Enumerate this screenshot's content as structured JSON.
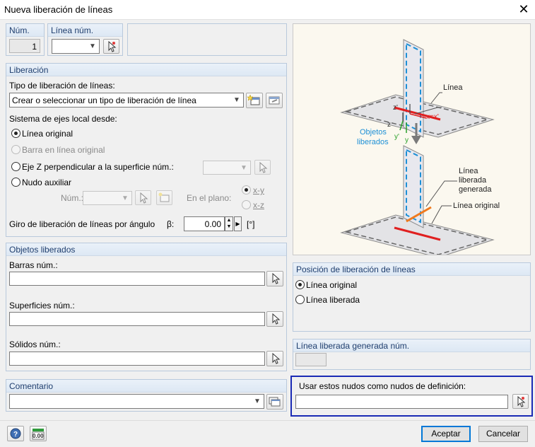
{
  "window": {
    "title": "Nueva liberación de líneas",
    "close_glyph": "✕"
  },
  "num": {
    "label": "Núm.",
    "value": "1"
  },
  "linea_num": {
    "label": "Línea núm.",
    "value": ""
  },
  "liberacion": {
    "header": "Liberación",
    "tipo_label": "Tipo de liberación de líneas:",
    "tipo_value": "Crear o seleccionar un tipo de liberación de línea",
    "sistema_label": "Sistema de ejes local desde:",
    "options": [
      {
        "label": "Línea original",
        "checked": true,
        "enabled": true
      },
      {
        "label": "Barra en línea original",
        "checked": false,
        "enabled": false
      },
      {
        "label": "Eje Z perpendicular a la superficie núm.:",
        "checked": false,
        "enabled": true
      },
      {
        "label": "Nudo auxiliar",
        "checked": false,
        "enabled": true
      }
    ],
    "nudo_num_label": "Núm.:",
    "en_plano_label": "En el plano:",
    "plano_options": [
      "x-y",
      "x-z"
    ],
    "giro_label": "Giro de liberación de líneas por ángulo",
    "beta_label": "β:",
    "beta_value": "0.00",
    "beta_unit": "[°]"
  },
  "objetos": {
    "header": "Objetos liberados",
    "barras_label": "Barras núm.:",
    "superficies_label": "Superficies núm.:",
    "solidos_label": "Sólidos núm.:"
  },
  "comentario": {
    "header": "Comentario",
    "value": ""
  },
  "diagram": {
    "linea": "Línea",
    "xx": "x=x'",
    "z_prime": "z'",
    "z": "z",
    "y_prime": "y'",
    "y": "y",
    "objetos_1": "Objetos",
    "objetos_2": "liberados",
    "gen_1": "Línea",
    "gen_2": "liberada",
    "gen_3": "generada",
    "linea_original": "Línea original"
  },
  "posicion": {
    "header": "Posición de liberación de líneas",
    "options": [
      {
        "label": "Línea original",
        "checked": true
      },
      {
        "label": "Línea liberada",
        "checked": false
      }
    ]
  },
  "generada": {
    "header": "Línea liberada generada núm.",
    "value": ""
  },
  "nudos": {
    "label": "Usar estos nudos como nudos de definición:",
    "value": ""
  },
  "footer": {
    "units_icon_text": "0.00",
    "ok": "Aceptar",
    "cancel": "Cancelar"
  },
  "colors": {
    "accent": "#0078d7",
    "highlight_border": "#1b2bb5",
    "group_title": "#1f3e6e",
    "diagram_blue": "#1e90d6",
    "diagram_red": "#e02020",
    "diagram_orange": "#f07a1e"
  }
}
